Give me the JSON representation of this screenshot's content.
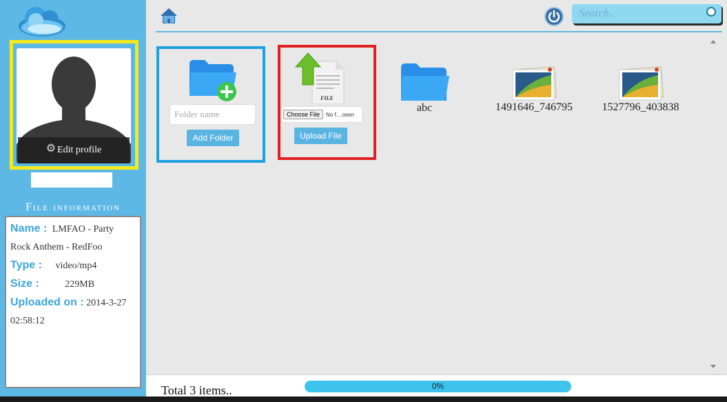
{
  "sidebar": {
    "logo_icon": "cloud-logo-icon",
    "profile": {
      "edit_label": "Edit profile",
      "avatar_icon": "person-silhouette-icon",
      "username": ""
    },
    "file_information": {
      "title": "File information",
      "name_key": "Name :",
      "name_value": "LMFAO - Party Rock Anthem - RedFoo",
      "type_key": "Type :",
      "type_value": "video/mp4",
      "size_key": "Size :",
      "size_value": "229MB",
      "uploaded_key": "Uploaded on :",
      "uploaded_value": "2014-3-27 02:58:12"
    }
  },
  "header": {
    "home_icon": "home-icon",
    "power_icon": "power-icon",
    "search": {
      "placeholder": "Search..",
      "value": ""
    }
  },
  "add_folder": {
    "icon": "folder-plus-icon",
    "placeholder": "Folder name",
    "button_label": "Add Folder"
  },
  "upload": {
    "icon": "file-upload-icon",
    "choose_label": "Choose File",
    "no_file_label": "No f....osen",
    "button_label": "Upload File"
  },
  "items": [
    {
      "type": "folder",
      "label": "abc",
      "icon": "folder-icon"
    },
    {
      "type": "image",
      "label": "1491646_746795",
      "icon": "image-file-icon"
    },
    {
      "type": "image",
      "label": "1527796_403838",
      "icon": "image-file-icon"
    }
  ],
  "footer": {
    "total_text": "Total 3 items..",
    "progress_label": "0%",
    "progress_value": 0
  },
  "colors": {
    "sidebar": "#5db8e6",
    "highlight_yellow": "#f4ea1b",
    "highlight_blue": "#1ea0e0",
    "highlight_red": "#e02020",
    "accent": "#3ba6de",
    "button": "#5ab4e2",
    "progress": "#3ec3ee"
  }
}
